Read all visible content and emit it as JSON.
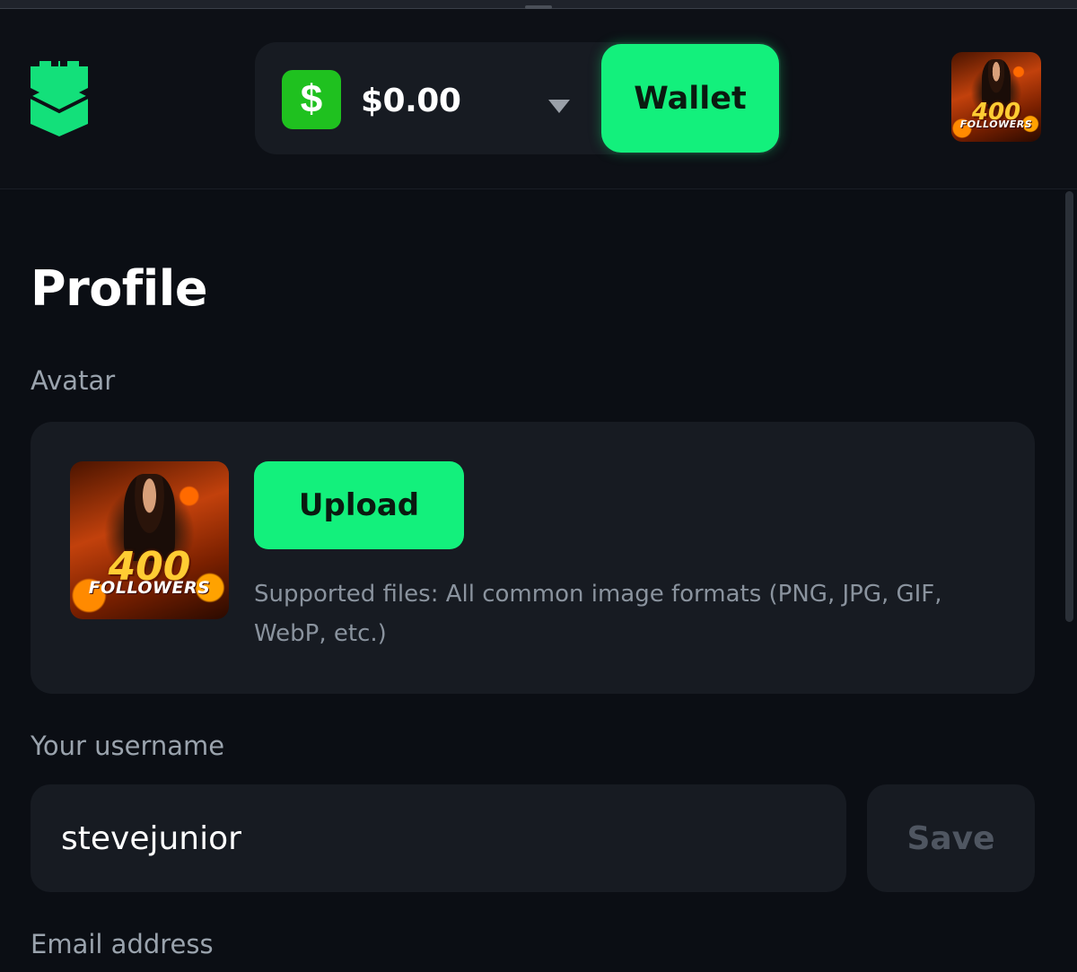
{
  "header": {
    "logo_icon": "castle-logo-icon",
    "wallet": {
      "currency_icon": "dollar-icon",
      "currency_symbol": "$",
      "balance": "$0.00",
      "dropdown_icon": "caret-down-icon",
      "button_label": "Wallet"
    },
    "user_avatar": {
      "art_big": "400",
      "art_small": "FOLLOWERS"
    }
  },
  "profile": {
    "title": "Profile",
    "avatar": {
      "label": "Avatar",
      "image": {
        "art_big": "400",
        "art_small": "FOLLOWERS"
      },
      "upload_label": "Upload",
      "supported_text": "Supported files: All common image formats (PNG, JPG, GIF, WebP, etc.)"
    },
    "username": {
      "label": "Your username",
      "value": "stevejunior",
      "save_label": "Save"
    },
    "email": {
      "label": "Email address"
    }
  },
  "colors": {
    "background": "#0b0e14",
    "card": "#171b22",
    "accent": "#13f07c",
    "currency_green": "#1fc11f",
    "muted_text": "#9aa3ad"
  }
}
